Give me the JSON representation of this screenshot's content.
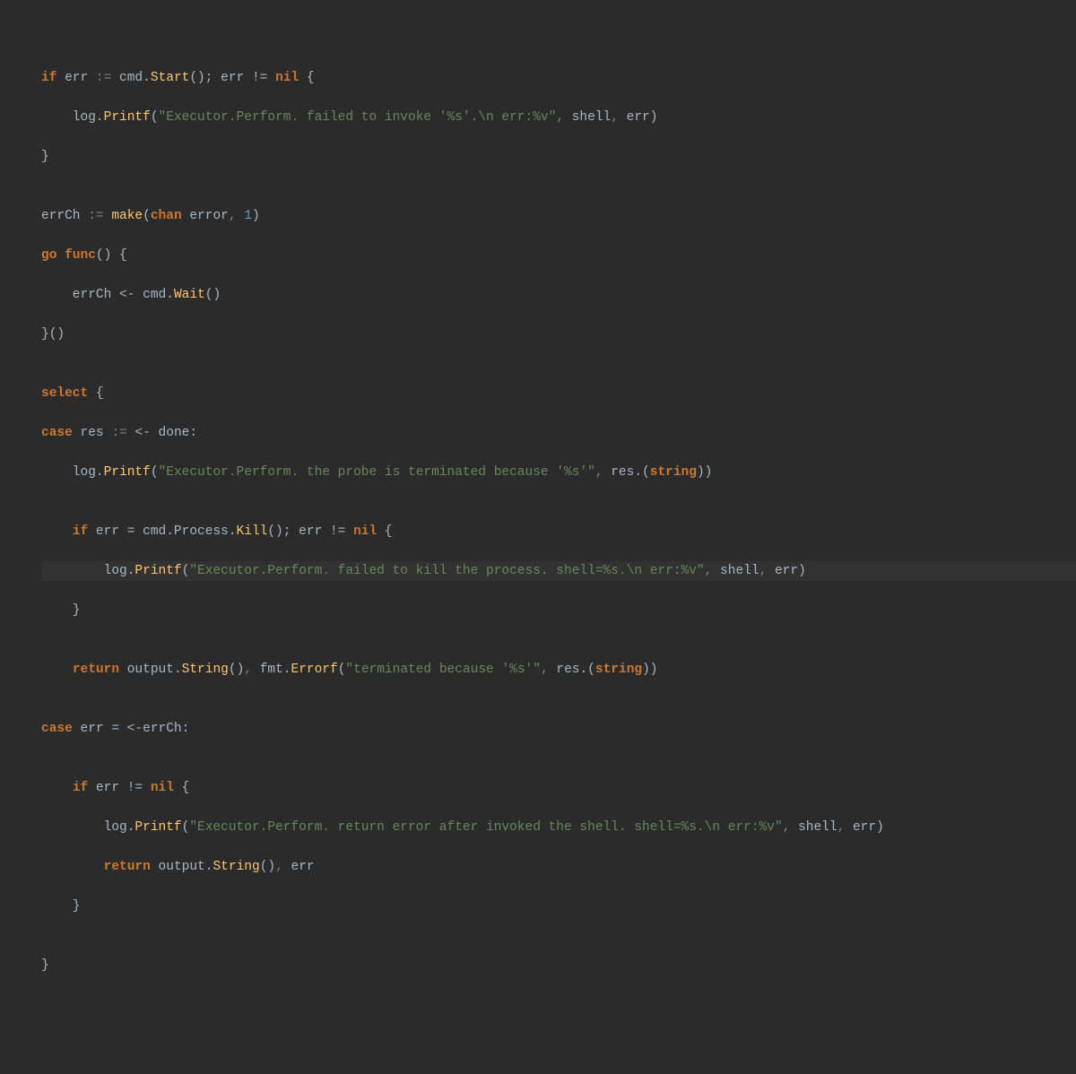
{
  "code": {
    "lines": [
      {
        "highlight": false,
        "tokens": [
          {
            "cls": "kw",
            "t": "if"
          },
          {
            "cls": "id",
            "t": " err "
          },
          {
            "cls": "pale",
            "t": ":= "
          },
          {
            "cls": "id",
            "t": "cmd."
          },
          {
            "cls": "fn",
            "t": "Start"
          },
          {
            "cls": "id",
            "t": "(); err != "
          },
          {
            "cls": "kw",
            "t": "nil"
          },
          {
            "cls": "id",
            "t": " {"
          }
        ]
      },
      {
        "highlight": false,
        "tokens": [
          {
            "cls": "id",
            "t": "    log."
          },
          {
            "cls": "fn",
            "t": "Printf"
          },
          {
            "cls": "id",
            "t": "("
          },
          {
            "cls": "str",
            "t": "\"Executor.Perform. failed to invoke '%s'.\\n err:%v\""
          },
          {
            "cls": "pale",
            "t": ", "
          },
          {
            "cls": "id",
            "t": "shell"
          },
          {
            "cls": "pale",
            "t": ", "
          },
          {
            "cls": "id",
            "t": "err)"
          }
        ]
      },
      {
        "highlight": false,
        "tokens": [
          {
            "cls": "id",
            "t": "}"
          }
        ]
      },
      {
        "highlight": false,
        "tokens": [
          {
            "cls": "id",
            "t": ""
          }
        ]
      },
      {
        "highlight": false,
        "tokens": [
          {
            "cls": "id",
            "t": "errCh "
          },
          {
            "cls": "pale",
            "t": ":= "
          },
          {
            "cls": "fn",
            "t": "make"
          },
          {
            "cls": "id",
            "t": "("
          },
          {
            "cls": "kw",
            "t": "chan"
          },
          {
            "cls": "id",
            "t": " error"
          },
          {
            "cls": "pale",
            "t": ", "
          },
          {
            "cls": "num",
            "t": "1"
          },
          {
            "cls": "id",
            "t": ")"
          }
        ]
      },
      {
        "highlight": false,
        "tokens": [
          {
            "cls": "kw",
            "t": "go func"
          },
          {
            "cls": "id",
            "t": "() {"
          }
        ]
      },
      {
        "highlight": false,
        "tokens": [
          {
            "cls": "id",
            "t": "    errCh <- cmd."
          },
          {
            "cls": "fn",
            "t": "Wait"
          },
          {
            "cls": "id",
            "t": "()"
          }
        ]
      },
      {
        "highlight": false,
        "tokens": [
          {
            "cls": "id",
            "t": "}()"
          }
        ]
      },
      {
        "highlight": false,
        "tokens": [
          {
            "cls": "id",
            "t": ""
          }
        ]
      },
      {
        "highlight": false,
        "tokens": [
          {
            "cls": "kw",
            "t": "select"
          },
          {
            "cls": "id",
            "t": " {"
          }
        ]
      },
      {
        "highlight": false,
        "tokens": [
          {
            "cls": "kw",
            "t": "case"
          },
          {
            "cls": "id",
            "t": " res "
          },
          {
            "cls": "pale",
            "t": ":= "
          },
          {
            "cls": "id",
            "t": "<- done:"
          }
        ]
      },
      {
        "highlight": false,
        "tokens": [
          {
            "cls": "id",
            "t": "    log."
          },
          {
            "cls": "fn",
            "t": "Printf"
          },
          {
            "cls": "id",
            "t": "("
          },
          {
            "cls": "str",
            "t": "\"Executor.Perform. the probe is terminated because '%s'\""
          },
          {
            "cls": "pale",
            "t": ", "
          },
          {
            "cls": "id",
            "t": "res.("
          },
          {
            "cls": "kw",
            "t": "string"
          },
          {
            "cls": "id",
            "t": "))"
          }
        ]
      },
      {
        "highlight": false,
        "tokens": [
          {
            "cls": "id",
            "t": ""
          }
        ]
      },
      {
        "highlight": false,
        "tokens": [
          {
            "cls": "id",
            "t": "    "
          },
          {
            "cls": "kw",
            "t": "if"
          },
          {
            "cls": "id",
            "t": " err = cmd.Process."
          },
          {
            "cls": "fn",
            "t": "Kill"
          },
          {
            "cls": "id",
            "t": "(); err != "
          },
          {
            "cls": "kw",
            "t": "nil"
          },
          {
            "cls": "id",
            "t": " {"
          }
        ]
      },
      {
        "highlight": true,
        "tokens": [
          {
            "cls": "id",
            "t": "        log."
          },
          {
            "cls": "fn",
            "t": "Printf"
          },
          {
            "cls": "id",
            "t": "("
          },
          {
            "cls": "str",
            "t": "\"Executor.Perform. failed to kill the process. shell=%s.\\n err:%v\""
          },
          {
            "cls": "pale",
            "t": ", "
          },
          {
            "cls": "id",
            "t": "shell"
          },
          {
            "cls": "pale",
            "t": ", "
          },
          {
            "cls": "id",
            "t": "err)"
          }
        ]
      },
      {
        "highlight": false,
        "tokens": [
          {
            "cls": "id",
            "t": "    }"
          }
        ]
      },
      {
        "highlight": false,
        "tokens": [
          {
            "cls": "id",
            "t": ""
          }
        ]
      },
      {
        "highlight": false,
        "tokens": [
          {
            "cls": "id",
            "t": "    "
          },
          {
            "cls": "kw",
            "t": "return"
          },
          {
            "cls": "id",
            "t": " output."
          },
          {
            "cls": "fn",
            "t": "String"
          },
          {
            "cls": "id",
            "t": "()"
          },
          {
            "cls": "pale",
            "t": ", "
          },
          {
            "cls": "id",
            "t": "fmt."
          },
          {
            "cls": "fn",
            "t": "Errorf"
          },
          {
            "cls": "id",
            "t": "("
          },
          {
            "cls": "str",
            "t": "\"terminated because '%s'\""
          },
          {
            "cls": "pale",
            "t": ", "
          },
          {
            "cls": "id",
            "t": "res.("
          },
          {
            "cls": "kw",
            "t": "string"
          },
          {
            "cls": "id",
            "t": "))"
          }
        ]
      },
      {
        "highlight": false,
        "tokens": [
          {
            "cls": "id",
            "t": ""
          }
        ]
      },
      {
        "highlight": false,
        "tokens": [
          {
            "cls": "kw",
            "t": "case"
          },
          {
            "cls": "id",
            "t": " err = <-errCh:"
          }
        ]
      },
      {
        "highlight": false,
        "tokens": [
          {
            "cls": "id",
            "t": ""
          }
        ]
      },
      {
        "highlight": false,
        "tokens": [
          {
            "cls": "id",
            "t": "    "
          },
          {
            "cls": "kw",
            "t": "if"
          },
          {
            "cls": "id",
            "t": " err != "
          },
          {
            "cls": "kw",
            "t": "nil"
          },
          {
            "cls": "id",
            "t": " {"
          }
        ]
      },
      {
        "highlight": false,
        "tokens": [
          {
            "cls": "id",
            "t": "        log."
          },
          {
            "cls": "fn",
            "t": "Printf"
          },
          {
            "cls": "id",
            "t": "("
          },
          {
            "cls": "str",
            "t": "\"Executor.Perform. return error after invoked the shell. shell=%s.\\n err:%v\""
          },
          {
            "cls": "pale",
            "t": ", "
          },
          {
            "cls": "id",
            "t": "shell"
          },
          {
            "cls": "pale",
            "t": ", "
          },
          {
            "cls": "id",
            "t": "err)"
          }
        ]
      },
      {
        "highlight": false,
        "tokens": [
          {
            "cls": "id",
            "t": "        "
          },
          {
            "cls": "kw",
            "t": "return"
          },
          {
            "cls": "id",
            "t": " output."
          },
          {
            "cls": "fn",
            "t": "String"
          },
          {
            "cls": "id",
            "t": "()"
          },
          {
            "cls": "pale",
            "t": ", "
          },
          {
            "cls": "id",
            "t": "err"
          }
        ]
      },
      {
        "highlight": false,
        "tokens": [
          {
            "cls": "id",
            "t": "    }"
          }
        ]
      },
      {
        "highlight": false,
        "tokens": [
          {
            "cls": "id",
            "t": ""
          }
        ]
      },
      {
        "highlight": false,
        "tokens": [
          {
            "cls": "id",
            "t": "}"
          }
        ]
      }
    ]
  }
}
